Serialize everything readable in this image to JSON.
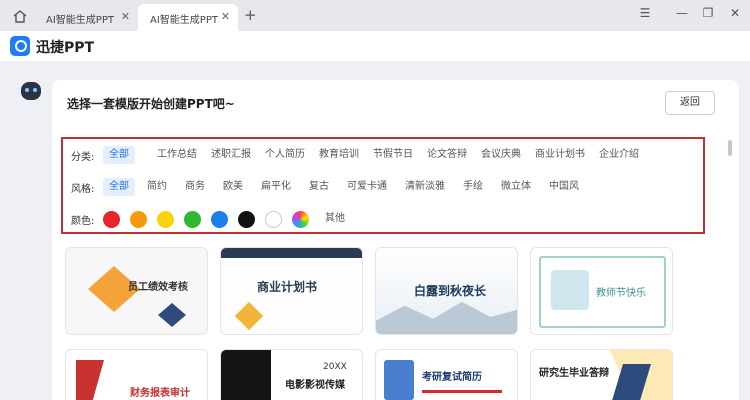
{
  "tabs": [
    {
      "label": "AI智能生成PPT"
    },
    {
      "label": "AI智能生成PPT"
    }
  ],
  "app": {
    "name": "迅捷PPT"
  },
  "main": {
    "heading": "选择一套模版开始创建PPT吧~",
    "back_label": "返回"
  },
  "filters": {
    "category": {
      "label": "分类:",
      "options": [
        "全部",
        "工作总结",
        "述职汇报",
        "个人简历",
        "教育培训",
        "节假节日",
        "论文答辩",
        "会议庆典",
        "商业计划书",
        "企业介绍"
      ],
      "selected": "全部"
    },
    "style": {
      "label": "风格:",
      "options": [
        "全部",
        "简约",
        "商务",
        "欧美",
        "扁平化",
        "复古",
        "可爱卡通",
        "清新淡雅",
        "手绘",
        "微立体",
        "中国风"
      ],
      "selected": "全部"
    },
    "color": {
      "label": "颜色:",
      "swatches": [
        "#e8242c",
        "#f59a0c",
        "#f7d40e",
        "#2fb92f",
        "#1a7fe6",
        "#111111",
        "#ffffff",
        "rainbow"
      ],
      "other_label": "其他"
    }
  },
  "templates": [
    {
      "title": "员工绩效考核"
    },
    {
      "title": "商业计划书"
    },
    {
      "title": "白露到秋夜长"
    },
    {
      "title": "教师节快乐"
    },
    {
      "title": "财务报表审计"
    },
    {
      "title": "电影影视传媒",
      "tag": "20XX"
    },
    {
      "title": "考研复试简历"
    },
    {
      "title": "研究生毕业答辩"
    }
  ]
}
